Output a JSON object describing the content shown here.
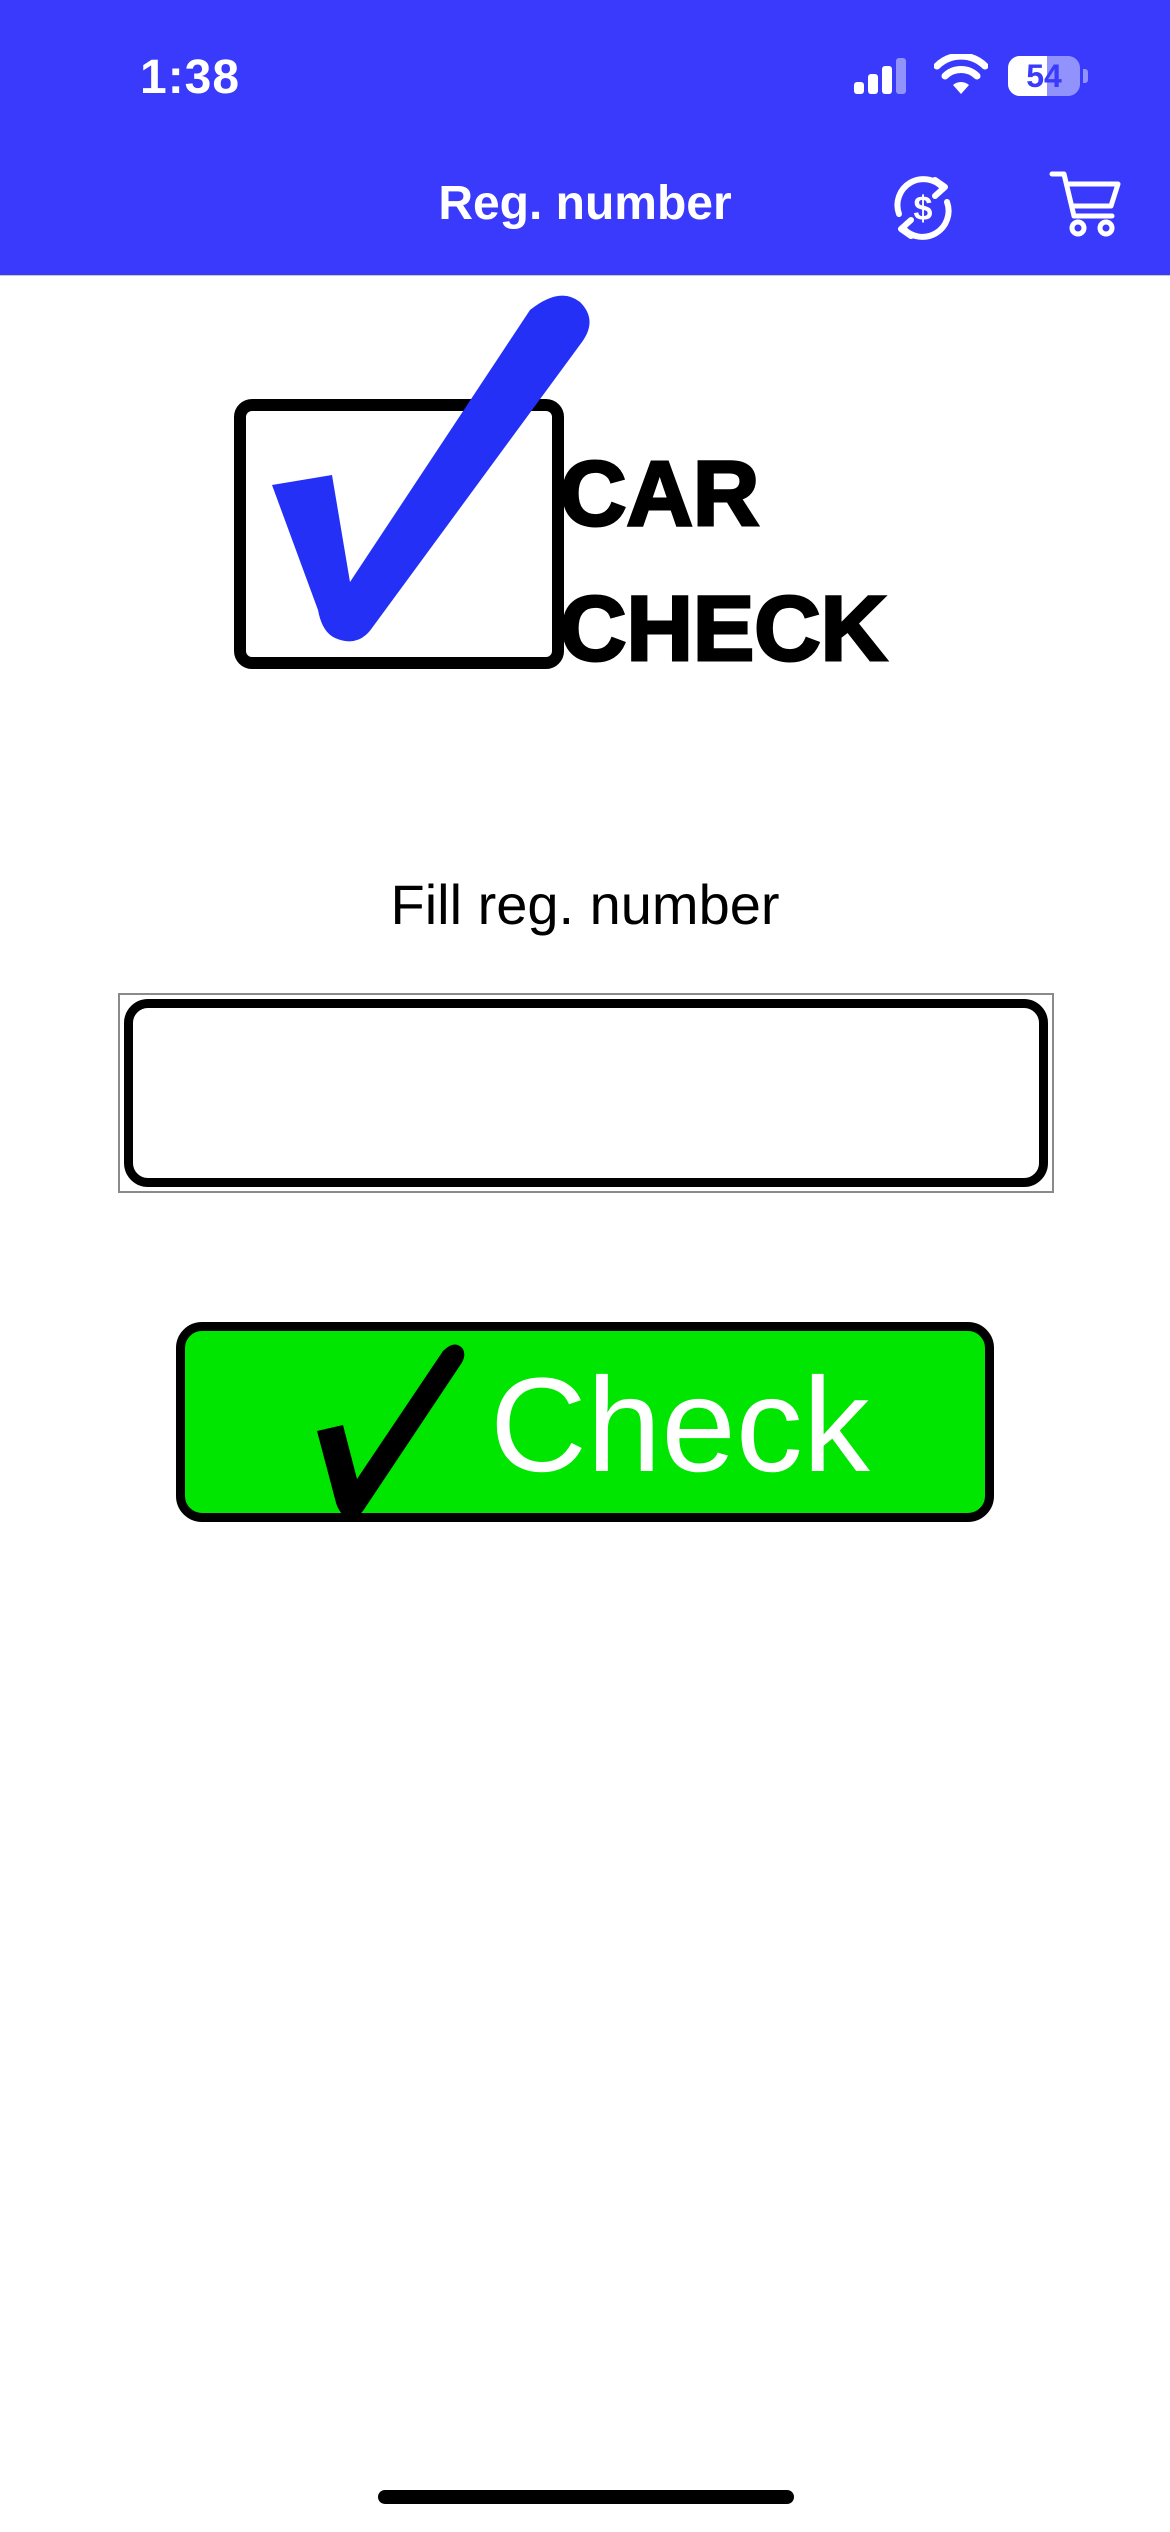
{
  "status_bar": {
    "time": "1:38",
    "battery_level": "54",
    "battery_fraction": 0.54
  },
  "nav": {
    "title": "Reg. number",
    "currency_icon": "currency-exchange-icon",
    "cart_icon": "shopping-cart-icon"
  },
  "logo": {
    "line1": "CAR",
    "line2": "CHECK"
  },
  "form": {
    "label": "Fill reg. number",
    "reg_value": "",
    "reg_placeholder": ""
  },
  "check_button": {
    "label": "Check",
    "icon": "checkmark-icon"
  },
  "colors": {
    "header_bg": "#3a3afc",
    "button_bg": "#00e600",
    "logo_check": "#2430f5"
  }
}
